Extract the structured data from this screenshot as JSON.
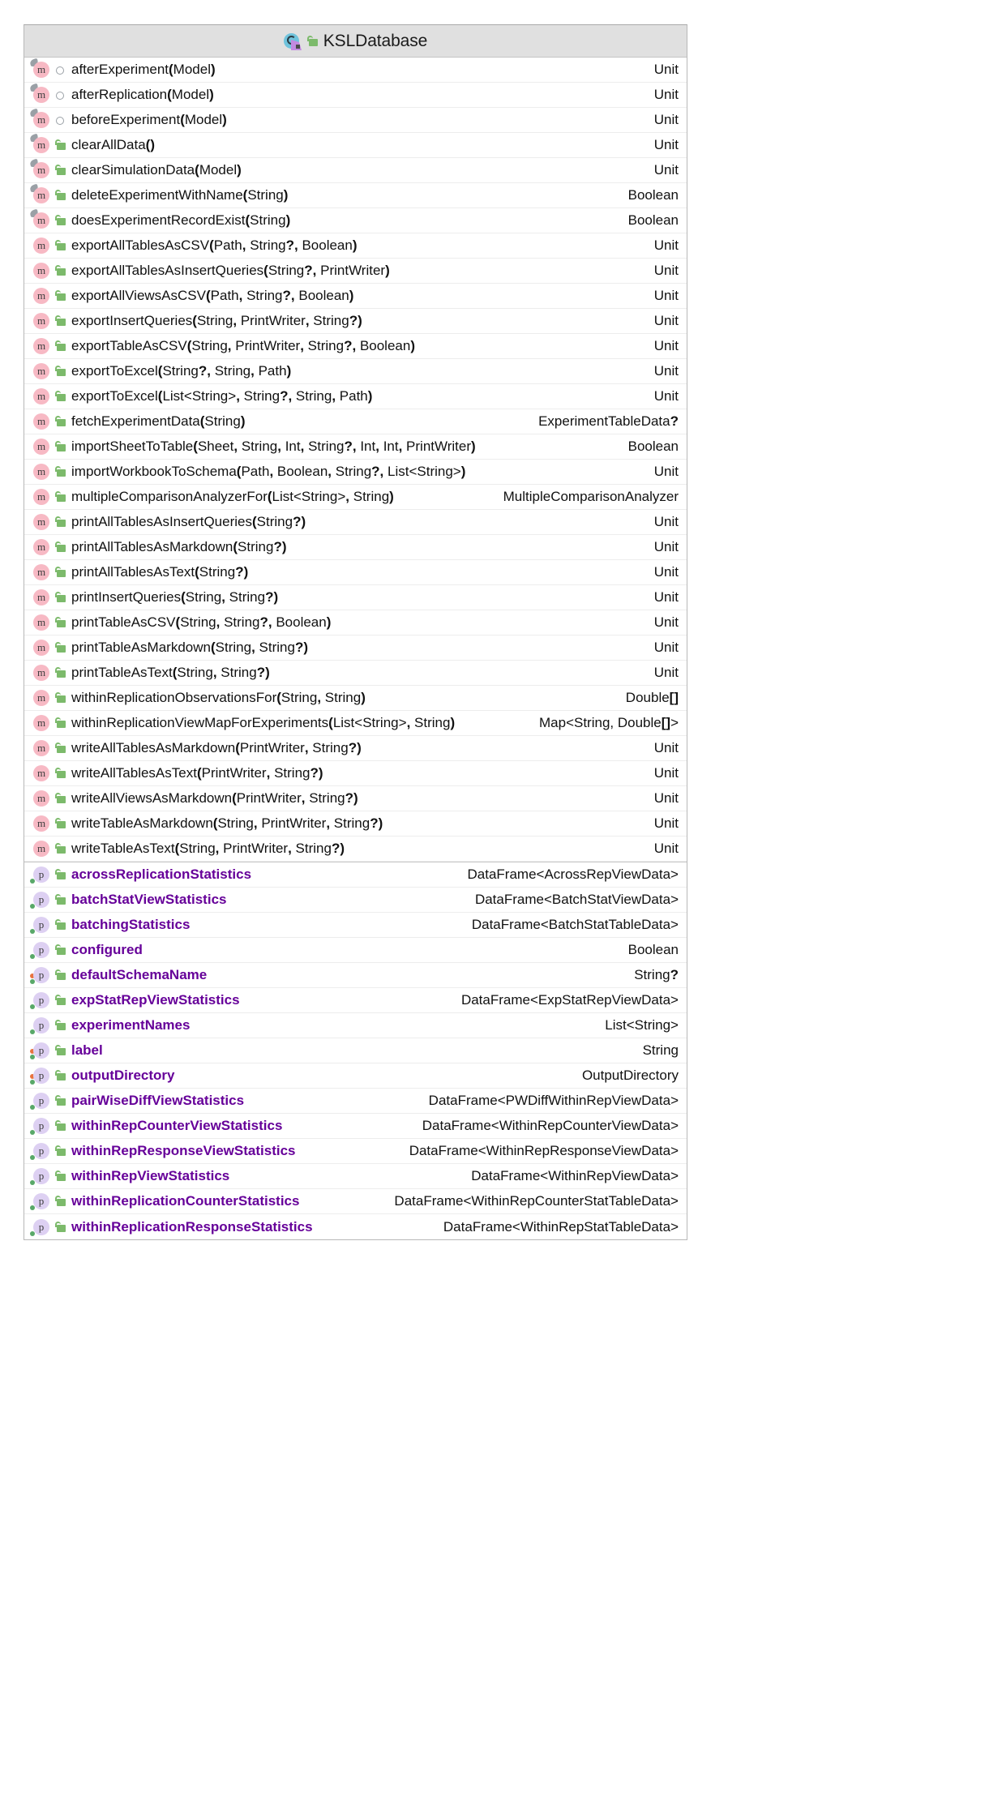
{
  "header": {
    "title": "KSLDatabase",
    "class_icon": "kotlin-class-icon",
    "visibility_icon": "public-unlocked-icon"
  },
  "sections": [
    {
      "name": "methods",
      "kind": "m",
      "rows": [
        {
          "badge": "m",
          "override": true,
          "vis": "protected",
          "name": "afterExperiment",
          "params": "Model",
          "nullable_params": [],
          "ret": "Unit"
        },
        {
          "badge": "m",
          "override": true,
          "vis": "protected",
          "name": "afterReplication",
          "params": "Model",
          "ret": "Unit"
        },
        {
          "badge": "m",
          "override": true,
          "vis": "protected",
          "name": "beforeExperiment",
          "params": "Model",
          "ret": "Unit"
        },
        {
          "badge": "m",
          "override": true,
          "vis": "public",
          "name": "clearAllData",
          "params": "",
          "ret": "Unit"
        },
        {
          "badge": "m",
          "override": true,
          "vis": "public",
          "name": "clearSimulationData",
          "params": "Model",
          "ret": "Unit"
        },
        {
          "badge": "m",
          "override": true,
          "vis": "public",
          "name": "deleteExperimentWithName",
          "params": "String",
          "ret": "Boolean"
        },
        {
          "badge": "m",
          "override": true,
          "vis": "public",
          "name": "doesExperimentRecordExist",
          "params": "String",
          "ret": "Boolean"
        },
        {
          "badge": "m",
          "override": false,
          "vis": "public",
          "name": "exportAllTablesAsCSV",
          "params": "Path, String?, Boolean",
          "ret": "Unit"
        },
        {
          "badge": "m",
          "override": false,
          "vis": "public",
          "name": "exportAllTablesAsInsertQueries",
          "params": "String?, PrintWriter",
          "ret": "Unit"
        },
        {
          "badge": "m",
          "override": false,
          "vis": "public",
          "name": "exportAllViewsAsCSV",
          "params": "Path, String?, Boolean",
          "ret": "Unit"
        },
        {
          "badge": "m",
          "override": false,
          "vis": "public",
          "name": "exportInsertQueries",
          "params": "String, PrintWriter, String?",
          "ret": "Unit"
        },
        {
          "badge": "m",
          "override": false,
          "vis": "public",
          "name": "exportTableAsCSV",
          "params": "String, PrintWriter, String?, Boolean",
          "ret": "Unit"
        },
        {
          "badge": "m",
          "override": false,
          "vis": "public",
          "name": "exportToExcel",
          "params": "String?, String, Path",
          "ret": "Unit"
        },
        {
          "badge": "m",
          "override": false,
          "vis": "public",
          "name": "exportToExcel",
          "params": "List<String>, String?, String, Path",
          "ret": "Unit"
        },
        {
          "badge": "m",
          "override": false,
          "vis": "public",
          "name": "fetchExperimentData",
          "params": "String",
          "ret": "ExperimentTableData?"
        },
        {
          "badge": "m",
          "override": false,
          "vis": "public",
          "name": "importSheetToTable",
          "params": "Sheet, String, Int, String?, Int, Int, PrintWriter",
          "ret": "Boolean"
        },
        {
          "badge": "m",
          "override": false,
          "vis": "public",
          "name": "importWorkbookToSchema",
          "params": "Path, Boolean, String?, List<String>",
          "ret": "Unit"
        },
        {
          "badge": "m",
          "override": false,
          "vis": "public",
          "name": "multipleComparisonAnalyzerFor",
          "params": "List<String>, String",
          "ret": "MultipleComparisonAnalyzer"
        },
        {
          "badge": "m",
          "override": false,
          "vis": "public",
          "name": "printAllTablesAsInsertQueries",
          "params": "String?",
          "ret": "Unit"
        },
        {
          "badge": "m",
          "override": false,
          "vis": "public",
          "name": "printAllTablesAsMarkdown",
          "params": "String?",
          "ret": "Unit"
        },
        {
          "badge": "m",
          "override": false,
          "vis": "public",
          "name": "printAllTablesAsText",
          "params": "String?",
          "ret": "Unit"
        },
        {
          "badge": "m",
          "override": false,
          "vis": "public",
          "name": "printInsertQueries",
          "params": "String, String?",
          "ret": "Unit"
        },
        {
          "badge": "m",
          "override": false,
          "vis": "public",
          "name": "printTableAsCSV",
          "params": "String, String?, Boolean",
          "ret": "Unit"
        },
        {
          "badge": "m",
          "override": false,
          "vis": "public",
          "name": "printTableAsMarkdown",
          "params": "String, String?",
          "ret": "Unit"
        },
        {
          "badge": "m",
          "override": false,
          "vis": "public",
          "name": "printTableAsText",
          "params": "String, String?",
          "ret": "Unit"
        },
        {
          "badge": "m",
          "override": false,
          "vis": "public",
          "name": "withinReplicationObservationsFor",
          "params": "String, String",
          "ret": "Double[]"
        },
        {
          "badge": "m",
          "override": false,
          "vis": "public",
          "name": "withinReplicationViewMapForExperiments",
          "params": "List<String>, String",
          "ret": "Map<String, Double[]>"
        },
        {
          "badge": "m",
          "override": false,
          "vis": "public",
          "name": "writeAllTablesAsMarkdown",
          "params": "PrintWriter, String?",
          "ret": "Unit"
        },
        {
          "badge": "m",
          "override": false,
          "vis": "public",
          "name": "writeAllTablesAsText",
          "params": "PrintWriter, String?",
          "ret": "Unit"
        },
        {
          "badge": "m",
          "override": false,
          "vis": "public",
          "name": "writeAllViewsAsMarkdown",
          "params": "PrintWriter, String?",
          "ret": "Unit"
        },
        {
          "badge": "m",
          "override": false,
          "vis": "public",
          "name": "writeTableAsMarkdown",
          "params": "String, PrintWriter, String?",
          "ret": "Unit"
        },
        {
          "badge": "m",
          "override": false,
          "vis": "public",
          "name": "writeTableAsText",
          "params": "String, PrintWriter, String?",
          "ret": "Unit"
        }
      ]
    },
    {
      "name": "properties",
      "kind": "p",
      "rows": [
        {
          "badge": "p",
          "getter": true,
          "setter": false,
          "vis": "public",
          "name": "acrossReplicationStatistics",
          "ret": "DataFrame<AcrossRepViewData>"
        },
        {
          "badge": "p",
          "getter": true,
          "setter": false,
          "vis": "public",
          "name": "batchStatViewStatistics",
          "ret": "DataFrame<BatchStatViewData>"
        },
        {
          "badge": "p",
          "getter": true,
          "setter": false,
          "vis": "public",
          "name": "batchingStatistics",
          "ret": "DataFrame<BatchStatTableData>"
        },
        {
          "badge": "p",
          "getter": true,
          "setter": false,
          "vis": "public",
          "name": "configured",
          "ret": "Boolean"
        },
        {
          "badge": "p",
          "getter": true,
          "setter": true,
          "vis": "public",
          "name": "defaultSchemaName",
          "ret": "String?"
        },
        {
          "badge": "p",
          "getter": true,
          "setter": false,
          "vis": "public",
          "name": "expStatRepViewStatistics",
          "ret": "DataFrame<ExpStatRepViewData>"
        },
        {
          "badge": "p",
          "getter": true,
          "setter": false,
          "vis": "public",
          "name": "experimentNames",
          "ret": "List<String>"
        },
        {
          "badge": "p",
          "getter": true,
          "setter": true,
          "vis": "public",
          "name": "label",
          "ret": "String"
        },
        {
          "badge": "p",
          "getter": true,
          "setter": true,
          "vis": "public",
          "name": "outputDirectory",
          "ret": "OutputDirectory"
        },
        {
          "badge": "p",
          "getter": true,
          "setter": false,
          "vis": "public",
          "name": "pairWiseDiffViewStatistics",
          "ret": "DataFrame<PWDiffWithinRepViewData>"
        },
        {
          "badge": "p",
          "getter": true,
          "setter": false,
          "vis": "public",
          "name": "withinRepCounterViewStatistics",
          "ret": "DataFrame<WithinRepCounterViewData>"
        },
        {
          "badge": "p",
          "getter": true,
          "setter": false,
          "vis": "public",
          "name": "withinRepResponseViewStatistics",
          "ret": "DataFrame<WithinRepResponseViewData>"
        },
        {
          "badge": "p",
          "getter": true,
          "setter": false,
          "vis": "public",
          "name": "withinRepViewStatistics",
          "ret": "DataFrame<WithinRepViewData>"
        },
        {
          "badge": "p",
          "getter": true,
          "setter": false,
          "vis": "public",
          "name": "withinReplicationCounterStatistics",
          "ret": "DataFrame<WithinRepCounterStatTableData>"
        },
        {
          "badge": "p",
          "getter": true,
          "setter": false,
          "vis": "public",
          "name": "withinReplicationResponseStatistics",
          "ret": "DataFrame<WithinRepStatTableData>"
        }
      ]
    }
  ],
  "colors": {
    "header_bg": "#e0e0e0",
    "method_badge": "#f7b9c4",
    "property_badge": "#ddd0f2",
    "property_text": "#660099",
    "public_lock": "#7cba6b",
    "getter_dot": "#59a869",
    "setter_dot": "#e8733f",
    "class_icon": "#6fc3dc",
    "inherit_arrow": "#c38ae0"
  }
}
